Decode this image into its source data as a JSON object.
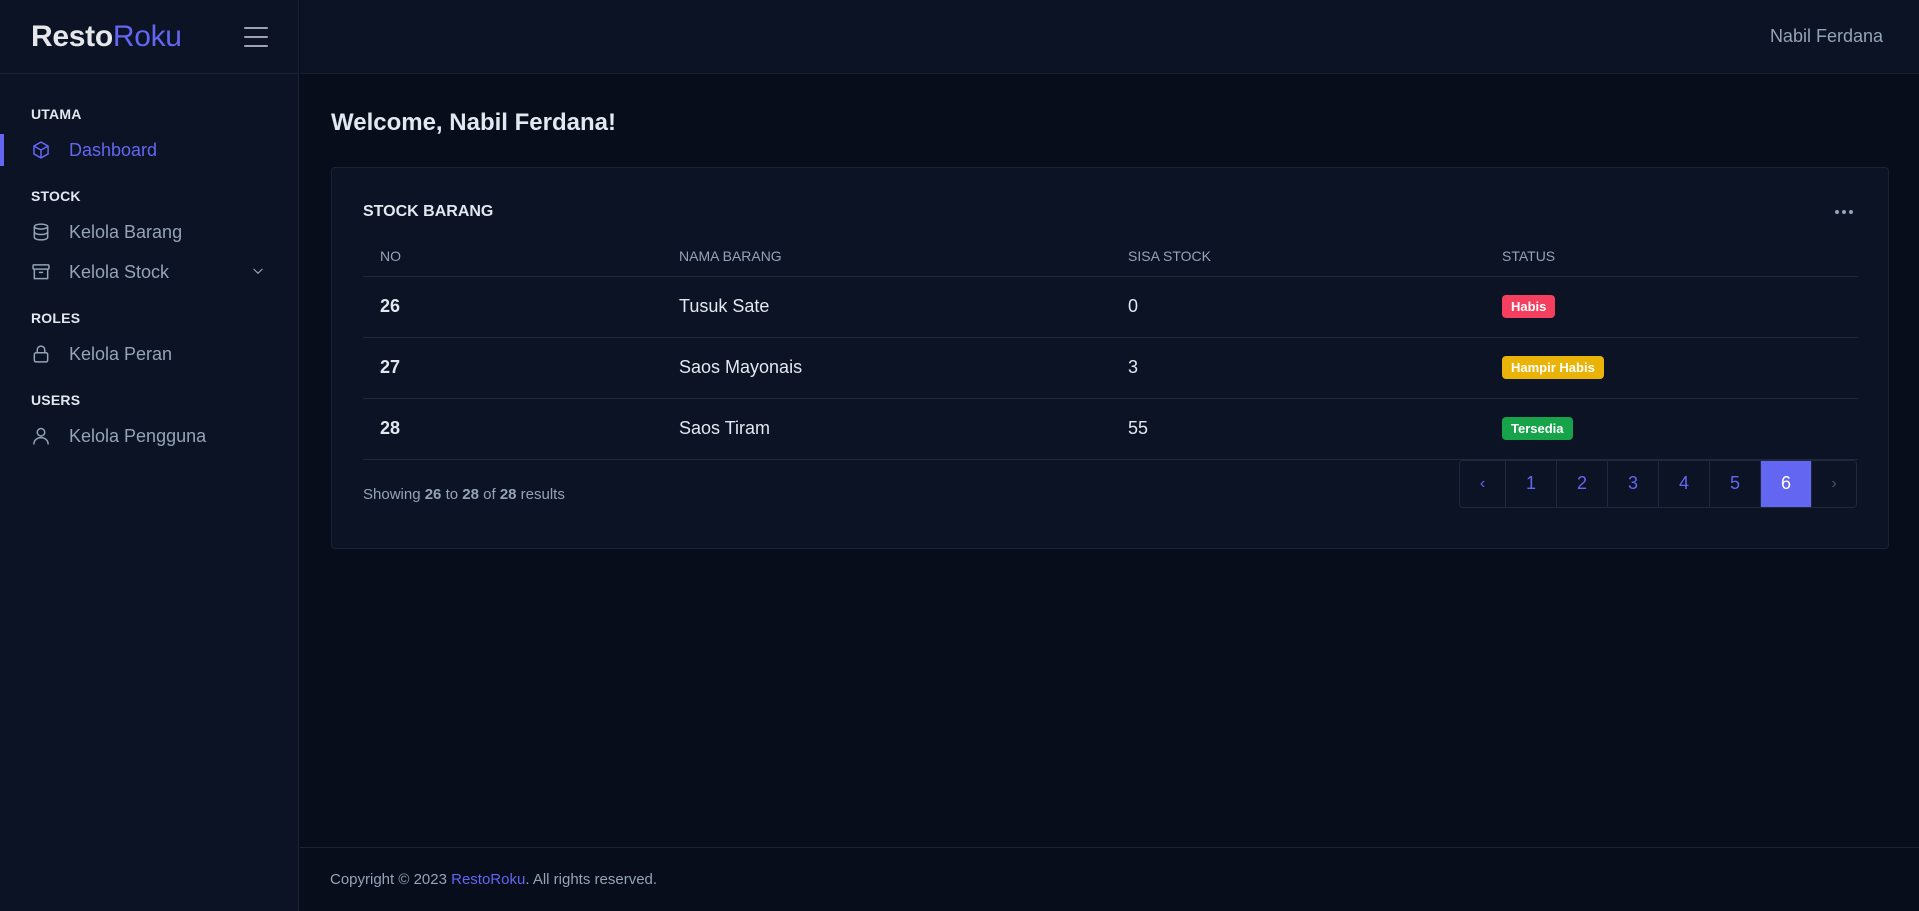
{
  "brand": {
    "part1": "Resto",
    "part2": "Roku"
  },
  "header": {
    "user_name": "Nabil Ferdana"
  },
  "sidebar": {
    "groups": [
      {
        "heading": "UTAMA",
        "items": [
          {
            "label": "Dashboard",
            "icon": "cube-icon"
          }
        ]
      },
      {
        "heading": "STOCK",
        "items": [
          {
            "label": "Kelola Barang",
            "icon": "database-icon"
          },
          {
            "label": "Kelola Stock",
            "icon": "archive-icon"
          }
        ]
      },
      {
        "heading": "ROLES",
        "items": [
          {
            "label": "Kelola Peran",
            "icon": "lock-icon"
          }
        ]
      },
      {
        "heading": "USERS",
        "items": [
          {
            "label": "Kelola Pengguna",
            "icon": "user-icon"
          }
        ]
      }
    ]
  },
  "main": {
    "welcome": "Welcome, Nabil Ferdana!",
    "card_title": "STOCK BARANG",
    "table": {
      "headers": [
        "NO",
        "NAMA BARANG",
        "SISA STOCK",
        "STATUS"
      ],
      "rows": [
        {
          "no": "26",
          "name": "Tusuk Sate",
          "stock": "0",
          "status": "Habis",
          "status_color": "#f43f5e"
        },
        {
          "no": "27",
          "name": "Saos Mayonais",
          "stock": "3",
          "status": "Hampir Habis",
          "status_color": "#eab308"
        },
        {
          "no": "28",
          "name": "Saos Tiram",
          "stock": "55",
          "status": "Tersedia",
          "status_color": "#16a34a"
        }
      ]
    },
    "showing": {
      "prefix": "Showing",
      "from": "26",
      "to_word": "to",
      "to": "28",
      "of_word": "of",
      "total": "28",
      "suffix": "results"
    },
    "pagination": {
      "prev": "‹",
      "pages": [
        "1",
        "2",
        "3",
        "4",
        "5",
        "6"
      ],
      "current": "6",
      "next": "›"
    }
  },
  "footer": {
    "copyright": "Copyright © 2023 ",
    "brand_link": "RestoRoku",
    "suffix": ". All rights reserved."
  },
  "colors": {
    "accent": "#6366f1",
    "background": "#070d1a",
    "panel": "#0b1324"
  }
}
